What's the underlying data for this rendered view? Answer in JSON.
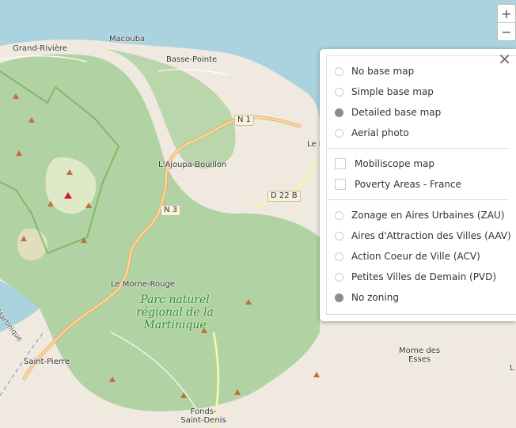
{
  "map": {
    "places": [
      {
        "name": "Grand-Rivière"
      },
      {
        "name": "Macouba"
      },
      {
        "name": "Basse-Pointe"
      },
      {
        "name": "L'Ajoupa-Bouillon"
      },
      {
        "name": "Le Morne-Rouge"
      },
      {
        "name": "Saint-Pierre"
      },
      {
        "name": "Morne des Esses"
      },
      {
        "name": "Fonds-Saint-Denis"
      },
      {
        "name": "Martinique"
      },
      {
        "name": "Le Lo"
      },
      {
        "name": "L"
      }
    ],
    "roads": [
      "N 1",
      "N 3",
      "D 22 B"
    ],
    "park_label": "Parc naturel régional de la Martinique",
    "colors": {
      "sea": "#aad3df",
      "land": "#efe9df",
      "forest": "#add19e",
      "park_boundary": "#66b24c",
      "primary_road": "#fcd6a4",
      "secondary_road": "#f7fabf",
      "peak": "#c1703a"
    }
  },
  "zoom": {
    "in_label": "+",
    "out_label": "−"
  },
  "panel": {
    "close_label": "✕",
    "base_maps": [
      {
        "label": "No base map",
        "selected": false
      },
      {
        "label": "Simple base map",
        "selected": false
      },
      {
        "label": "Detailed base map",
        "selected": true
      },
      {
        "label": "Aerial photo",
        "selected": false
      }
    ],
    "overlays": [
      {
        "label": "Mobiliscope map",
        "checked": false
      },
      {
        "label": "Poverty Areas - France",
        "checked": false
      }
    ],
    "zonings": [
      {
        "label": "Zonage en Aires Urbaines (ZAU)",
        "selected": false
      },
      {
        "label": "Aires d'Attraction des Villes (AAV)",
        "selected": false
      },
      {
        "label": "Action Coeur de Ville (ACV)",
        "selected": false
      },
      {
        "label": "Petites Villes de Demain (PVD)",
        "selected": false
      },
      {
        "label": "No zoning",
        "selected": true
      }
    ]
  }
}
